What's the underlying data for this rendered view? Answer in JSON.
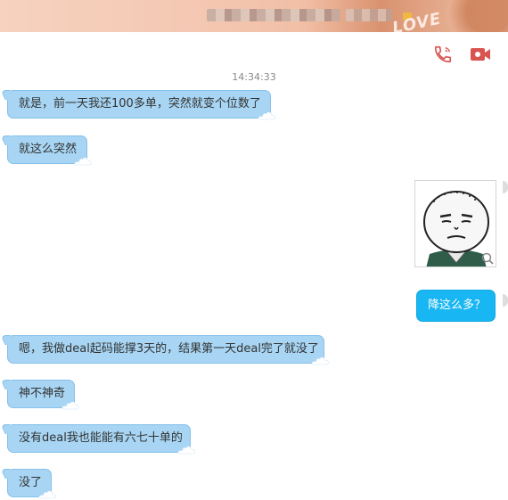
{
  "header": {},
  "toolbar": {
    "voice_call_icon": "phone-icon",
    "video_call_icon": "video-camera-icon",
    "icon_color": "#d9534f"
  },
  "chat": {
    "timestamp": "14:34:33",
    "messages": [
      {
        "side": "left",
        "text": "就是，前一天我还100多单，突然就变个位数了"
      },
      {
        "side": "left",
        "text": "就这么突然"
      },
      {
        "side": "right",
        "type": "sticker",
        "sticker": "meme-face-sticker"
      },
      {
        "side": "right",
        "text": "降这么多？"
      },
      {
        "side": "left",
        "text": "嗯，我做deal起码能撑3天的，结果第一天deal完了就没了"
      },
      {
        "side": "left",
        "text": "神不神奇"
      },
      {
        "side": "left",
        "text": "没有deal我也能能有六七十单的"
      },
      {
        "side": "left",
        "text": "没了"
      }
    ]
  },
  "colors": {
    "left_bubble": "#a7d5f3",
    "right_bubble": "#18b6f2"
  }
}
